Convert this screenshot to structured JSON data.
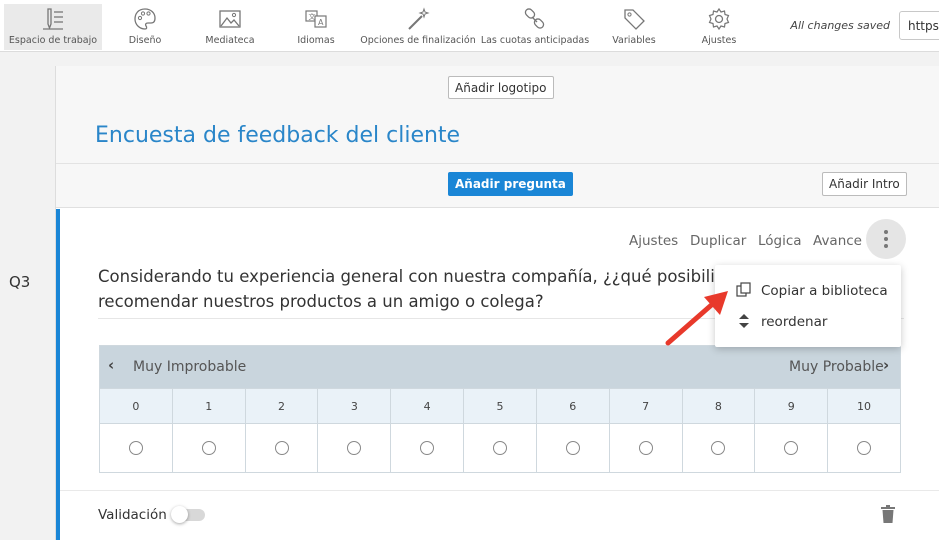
{
  "toolbar": {
    "items": [
      {
        "label": "Espacio de trabajo",
        "icon": "workspace-icon"
      },
      {
        "label": "Diseño",
        "icon": "palette-icon"
      },
      {
        "label": "Mediateca",
        "icon": "image-icon"
      },
      {
        "label": "Idiomas",
        "icon": "translate-icon"
      },
      {
        "label": "Opciones de finalización",
        "icon": "magic-wand-icon"
      },
      {
        "label": "Las cuotas anticipadas",
        "icon": "link-icon"
      },
      {
        "label": "Variables",
        "icon": "tag-icon"
      },
      {
        "label": "Ajustes",
        "icon": "gear-icon"
      }
    ],
    "saved_status": "All changes saved",
    "url_field": "https"
  },
  "survey": {
    "add_logo_label": "Añadir logotipo",
    "title": "Encuesta de feedback del cliente",
    "add_question_label": "Añadir pregunta",
    "add_intro_label": "Añadir Intro"
  },
  "question": {
    "number": "Q3",
    "actions": [
      "Ajustes",
      "Duplicar",
      "Lógica",
      "Avance"
    ],
    "text": "Considerando tu experiencia general con nuestra compañía, ¿¿qué posibilid recomendar nuestros productos a un amigo o colega?",
    "scale_low_label": "Muy Improbable",
    "scale_high_label": "Muy Probable",
    "scale_values": [
      "0",
      "1",
      "2",
      "3",
      "4",
      "5",
      "6",
      "7",
      "8",
      "9",
      "10"
    ],
    "validation_label": "Validación",
    "validation_enabled": false
  },
  "menu": {
    "items": [
      {
        "label": "Copiar a biblioteca",
        "icon": "copy-icon"
      },
      {
        "label": "reordenar",
        "icon": "sort-icon"
      }
    ]
  },
  "colors": {
    "accent": "#1a86d6",
    "title": "#2a86c9",
    "scale_header": "#c9d5dd",
    "annotation_arrow": "#e8392b"
  }
}
